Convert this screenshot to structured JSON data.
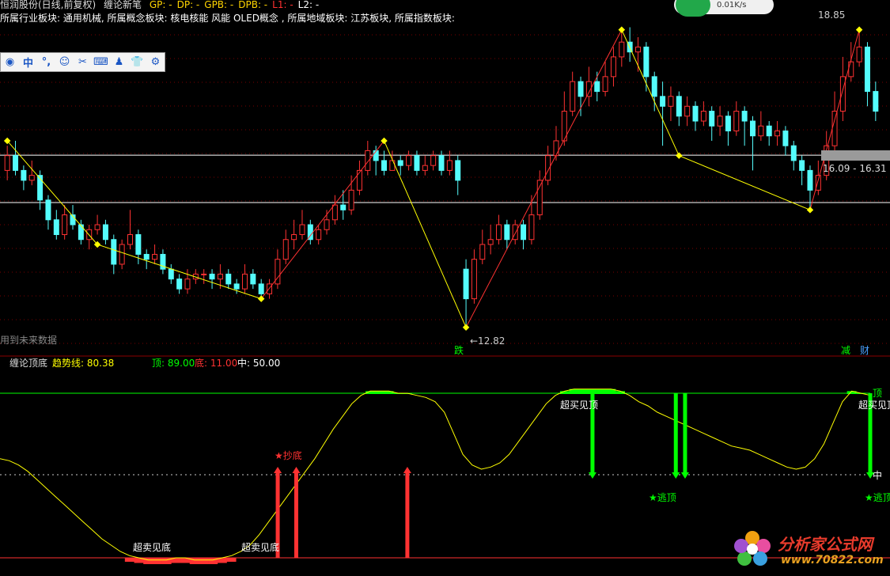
{
  "header": {
    "stock_title": "恒润股份(日线,前复权)",
    "indicator_name": "缠论新笔",
    "fields": [
      {
        "label": "GP: -",
        "color": "#ffd400"
      },
      {
        "label": "DP: -",
        "color": "#ffd400"
      },
      {
        "label": "GPB: -",
        "color": "#ffd400"
      },
      {
        "label": "DPB: -",
        "color": "#ffd400"
      },
      {
        "label": "L1: -",
        "color": "#ff3030"
      },
      {
        "label": "L2: -",
        "color": "#ffffff"
      }
    ],
    "sector_line": "所属行业板块: 通用机械, 所属概念板块: 核电核能 风能 OLED概念 , 所属地域板块: 江苏板块, 所属指数板块:"
  },
  "toolbar": {
    "icons": [
      "user-circle-icon",
      "chinese-input-icon",
      "punctuation-icon",
      "emoji-icon",
      "scissors-icon",
      "keyboard-icon",
      "person-icon",
      "shirt-icon",
      "gear-icon"
    ],
    "glyphs": [
      "◉",
      "中",
      "°,",
      "☺",
      "✂",
      "⌨",
      "♟",
      "👕",
      "⚙"
    ]
  },
  "speed_widget": {
    "value": "0.01K/s"
  },
  "upper": {
    "future_data_note": "用到未来数据",
    "price_high_label": "18.85",
    "price_low_label": "12.82",
    "range_label": "16.09 - 16.31",
    "marker_die": "跌",
    "marker_jian": "减",
    "marker_cai": "财"
  },
  "lower": {
    "indicator_title": "缠论顶底",
    "trend_label": "趋势线: 80.38",
    "top_label": "顶: 89.00",
    "bottom_label": "底: 11.00",
    "mid_label": "中: 50.00",
    "right_top": "顶",
    "right_mid": "中",
    "overbought_1": "超买见顶",
    "overbought_2": "超买见顶",
    "oversold_1": "超卖见底",
    "oversold_2": "超卖见底",
    "buy_signal": "★抄底",
    "sell_signal_1": "★逃顶",
    "sell_signal_2": "★逃顶"
  },
  "colors": {
    "up": "#ff3232",
    "down": "#54fcfc",
    "yellow": "#ffff00",
    "green": "#00ff00",
    "panel_line": "#8b0000"
  },
  "logo": {
    "name": "分析家公式网",
    "url": "www.70822.com"
  },
  "chart_data": [
    {
      "type": "candlestick",
      "description_free": true,
      "ylim": [
        12.4,
        19.1
      ],
      "horizontal_levels": [
        16.31,
        15.35
      ],
      "candles": [
        [
          16.0,
          16.3,
          16.5,
          15.8
        ],
        [
          16.3,
          16.0,
          16.6,
          15.9
        ],
        [
          16.0,
          15.8,
          16.1,
          15.6
        ],
        [
          15.8,
          15.9,
          16.2,
          15.7
        ],
        [
          15.9,
          15.4,
          16.0,
          15.2
        ],
        [
          15.4,
          15.0,
          15.5,
          14.8
        ],
        [
          15.0,
          14.7,
          15.2,
          14.6
        ],
        [
          14.7,
          15.1,
          15.3,
          14.6
        ],
        [
          15.1,
          14.9,
          15.3,
          14.8
        ],
        [
          14.9,
          14.6,
          15.0,
          14.5
        ],
        [
          14.6,
          14.8,
          14.9,
          14.4
        ],
        [
          14.8,
          14.9,
          15.1,
          14.7
        ],
        [
          14.9,
          14.6,
          15.0,
          14.5
        ],
        [
          14.6,
          14.1,
          14.7,
          13.9
        ],
        [
          14.1,
          14.5,
          14.6,
          14.0
        ],
        [
          14.5,
          14.7,
          15.2,
          14.4
        ],
        [
          14.7,
          14.3,
          14.8,
          14.1
        ],
        [
          14.3,
          14.2,
          14.4,
          14.0
        ],
        [
          14.2,
          14.3,
          14.5,
          14.1
        ],
        [
          14.3,
          14.0,
          14.4,
          13.9
        ],
        [
          14.0,
          13.8,
          14.1,
          13.7
        ],
        [
          13.8,
          13.6,
          13.9,
          13.5
        ],
        [
          13.6,
          13.8,
          14.0,
          13.5
        ],
        [
          13.8,
          13.9,
          14.0,
          13.7
        ],
        [
          13.9,
          13.9,
          14.0,
          13.7
        ],
        [
          13.9,
          13.8,
          14.0,
          13.6
        ],
        [
          13.8,
          13.9,
          14.1,
          13.6
        ],
        [
          13.9,
          13.7,
          14.0,
          13.6
        ],
        [
          13.7,
          13.6,
          13.8,
          13.5
        ],
        [
          13.6,
          13.9,
          14.1,
          13.5
        ],
        [
          13.9,
          13.7,
          14.0,
          13.6
        ],
        [
          13.7,
          13.5,
          13.8,
          13.4
        ],
        [
          13.5,
          13.7,
          13.8,
          13.4
        ],
        [
          13.7,
          14.2,
          14.4,
          13.6
        ],
        [
          14.2,
          14.6,
          14.8,
          14.1
        ],
        [
          14.6,
          14.7,
          15.0,
          14.4
        ],
        [
          14.7,
          14.9,
          15.2,
          14.6
        ],
        [
          14.9,
          14.6,
          15.0,
          14.5
        ],
        [
          14.6,
          14.8,
          14.9,
          14.5
        ],
        [
          14.8,
          15.0,
          15.2,
          14.7
        ],
        [
          15.0,
          15.3,
          15.5,
          14.9
        ],
        [
          15.3,
          15.2,
          15.6,
          15.0
        ],
        [
          15.2,
          15.6,
          15.9,
          15.1
        ],
        [
          15.6,
          16.0,
          16.2,
          15.5
        ],
        [
          16.0,
          16.4,
          16.6,
          15.9
        ],
        [
          16.4,
          16.2,
          16.5,
          15.9
        ],
        [
          16.2,
          16.0,
          16.4,
          15.9
        ],
        [
          16.0,
          16.2,
          16.4,
          16.0
        ],
        [
          16.2,
          16.1,
          16.3,
          15.9
        ],
        [
          16.1,
          16.3,
          16.4,
          16.0
        ],
        [
          16.3,
          16.0,
          16.4,
          15.9
        ],
        [
          16.0,
          16.1,
          16.3,
          15.9
        ],
        [
          16.1,
          16.3,
          16.4,
          16.0
        ],
        [
          16.3,
          16.0,
          16.4,
          15.9
        ],
        [
          16.0,
          16.2,
          16.4,
          15.9
        ],
        [
          16.2,
          15.8,
          16.3,
          15.5
        ],
        [
          14.0,
          13.4,
          14.2,
          12.82
        ],
        [
          13.4,
          14.2,
          14.4,
          13.3
        ],
        [
          14.2,
          14.5,
          14.8,
          14.1
        ],
        [
          14.5,
          14.6,
          14.9,
          14.3
        ],
        [
          14.6,
          14.9,
          15.1,
          14.5
        ],
        [
          14.9,
          14.6,
          15.0,
          14.4
        ],
        [
          14.6,
          14.9,
          15.0,
          14.5
        ],
        [
          14.9,
          14.6,
          15.0,
          14.4
        ],
        [
          14.6,
          15.1,
          15.5,
          14.5
        ],
        [
          15.1,
          15.8,
          16.0,
          15.0
        ],
        [
          15.8,
          16.3,
          16.5,
          15.7
        ],
        [
          16.3,
          16.6,
          16.9,
          16.2
        ],
        [
          16.6,
          17.2,
          17.6,
          16.5
        ],
        [
          17.2,
          17.8,
          18.0,
          17.1
        ],
        [
          17.8,
          17.5,
          17.9,
          17.1
        ],
        [
          17.5,
          17.8,
          18.1,
          17.3
        ],
        [
          17.8,
          17.6,
          18.0,
          17.4
        ],
        [
          17.6,
          17.9,
          18.2,
          17.5
        ],
        [
          17.9,
          18.3,
          18.5,
          17.7
        ],
        [
          18.3,
          18.6,
          18.8,
          18.1
        ],
        [
          18.6,
          18.4,
          18.9,
          18.2
        ],
        [
          18.4,
          18.5,
          18.7,
          18.0
        ],
        [
          18.5,
          17.9,
          18.6,
          17.6
        ],
        [
          17.9,
          17.5,
          18.0,
          17.2
        ],
        [
          17.5,
          17.3,
          17.8,
          16.5
        ],
        [
          17.3,
          17.5,
          17.7,
          17.0
        ],
        [
          17.5,
          17.1,
          17.6,
          16.9
        ],
        [
          17.1,
          17.3,
          17.5,
          16.9
        ],
        [
          17.3,
          17.0,
          17.4,
          16.8
        ],
        [
          17.0,
          17.2,
          17.4,
          16.9
        ],
        [
          17.2,
          16.9,
          17.3,
          16.6
        ],
        [
          16.9,
          17.1,
          17.3,
          16.7
        ],
        [
          17.1,
          16.8,
          17.2,
          16.5
        ],
        [
          16.8,
          17.2,
          17.4,
          16.7
        ],
        [
          17.2,
          17.0,
          17.3,
          16.5
        ],
        [
          17.0,
          16.7,
          17.1,
          16.0
        ],
        [
          16.7,
          16.9,
          17.2,
          16.6
        ],
        [
          16.9,
          16.7,
          17.0,
          16.5
        ],
        [
          16.7,
          16.8,
          17.0,
          16.5
        ],
        [
          16.8,
          16.5,
          16.9,
          16.3
        ],
        [
          16.5,
          16.2,
          16.6,
          16.0
        ],
        [
          16.2,
          16.0,
          16.3,
          15.7
        ],
        [
          16.0,
          15.6,
          16.1,
          15.2
        ],
        [
          15.6,
          15.9,
          16.2,
          15.5
        ],
        [
          15.9,
          16.5,
          16.8,
          15.8
        ],
        [
          16.5,
          17.2,
          17.6,
          16.4
        ],
        [
          17.2,
          17.9,
          18.3,
          17.0
        ],
        [
          17.9,
          18.2,
          18.6,
          17.8
        ],
        [
          18.2,
          18.5,
          18.85,
          18.1
        ],
        [
          18.5,
          17.6,
          18.6,
          17.3
        ],
        [
          17.6,
          17.2,
          17.8,
          17.0
        ]
      ],
      "pen_points": [
        [
          0,
          16.6
        ],
        [
          11,
          14.5
        ],
        [
          31,
          13.4
        ],
        [
          46,
          16.6
        ],
        [
          56,
          12.82
        ],
        [
          75,
          18.85
        ],
        [
          82,
          16.3
        ],
        [
          98,
          15.2
        ],
        [
          104,
          18.85
        ]
      ]
    },
    {
      "type": "line",
      "ylim": [
        0,
        100
      ],
      "levels": {
        "top": 89,
        "mid": 50,
        "bottom": 11
      },
      "series": [
        {
          "values": [
            58,
            57,
            55,
            52,
            48,
            44,
            40,
            36,
            32,
            28,
            24,
            20,
            17,
            14,
            12,
            11,
            10,
            10,
            10,
            11,
            11,
            10,
            10,
            10,
            11,
            12,
            14,
            17,
            22,
            28,
            34,
            40,
            46,
            52,
            58,
            65,
            72,
            78,
            84,
            88,
            90,
            90,
            90,
            89,
            89,
            88,
            87,
            85,
            80,
            70,
            60,
            55,
            53,
            54,
            56,
            60,
            66,
            72,
            78,
            84,
            88,
            90,
            91,
            91,
            91,
            91,
            91,
            90,
            88,
            85,
            83,
            80,
            78,
            76,
            74,
            72,
            70,
            68,
            66,
            64,
            63,
            62,
            60,
            58,
            56,
            54,
            53,
            54,
            58,
            65,
            75,
            85,
            90,
            89,
            88
          ]
        }
      ],
      "overbought_bars": [
        [
          61,
          95
        ],
        [
          62,
          96
        ],
        [
          63,
          97
        ],
        [
          64,
          96
        ],
        [
          65,
          95
        ],
        [
          66,
          94
        ],
        [
          67,
          95
        ],
        [
          68,
          96
        ],
        [
          69,
          95
        ]
      ],
      "signal_arrows_up": [
        30,
        32,
        44
      ],
      "signal_arrows_down": [
        64,
        73,
        74,
        94
      ]
    }
  ]
}
